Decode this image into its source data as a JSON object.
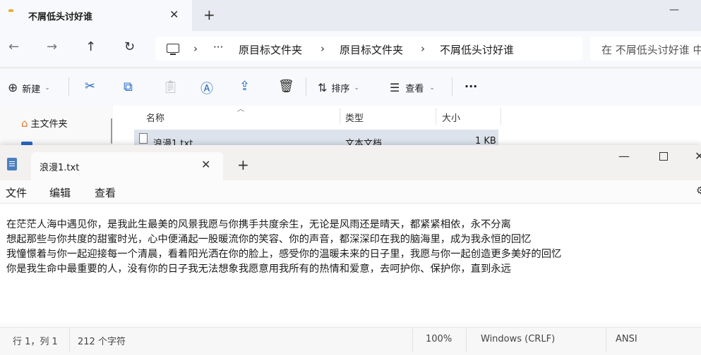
{
  "explorer": {
    "tab": {
      "title": "不屑低头讨好谁",
      "icon": "folder-icon"
    },
    "nav": {
      "breadcrumb": [
        "原目标文件夹",
        "原目标文件夹",
        "不屑低头讨好谁"
      ],
      "ellipsis": "···",
      "search_placeholder": "在 不屑低头讨好谁 中"
    },
    "toolbar": {
      "new_label": "新建",
      "sort_label": "排序",
      "view_label": "查看",
      "more_label": "···"
    },
    "sidebar": {
      "home_label": "主文件夹"
    },
    "columns": {
      "name": "名称",
      "type": "类型",
      "size": "大小"
    },
    "files": [
      {
        "name": "浪漫1.txt",
        "type": "文本文档",
        "size": "1 KB"
      }
    ]
  },
  "notepad": {
    "tab_title": "浪漫1.txt",
    "menu": {
      "file": "文件",
      "edit": "编辑",
      "view": "查看"
    },
    "content": [
      "在茫茫人海中遇见你，是我此生最美的风景我愿与你携手共度余生，无论是风雨还是晴天，都紧紧相依，永不分离",
      "想起那些与你共度的甜蜜时光，心中便涌起一股暖流你的笑容、你的声音，都深深印在我的脑海里，成为我永恒的回忆",
      "我憧憬着与你一起迎接每一个清晨，看着阳光洒在你的脸上，感受你的温暖未来的日子里，我愿与你一起创造更多美好的回忆",
      "你是我生命中最重要的人，没有你的日子我无法想象我愿意用我所有的热情和爱意，去呵护你、保护你，直到永远"
    ],
    "status": {
      "position": "行 1，列 1",
      "chars": "212 个字符",
      "zoom": "100%",
      "line_ending": "Windows (CRLF)",
      "encoding": "ANSI"
    }
  },
  "colors": {
    "accent": "#2a69c4",
    "selection": "#dde3ec"
  }
}
